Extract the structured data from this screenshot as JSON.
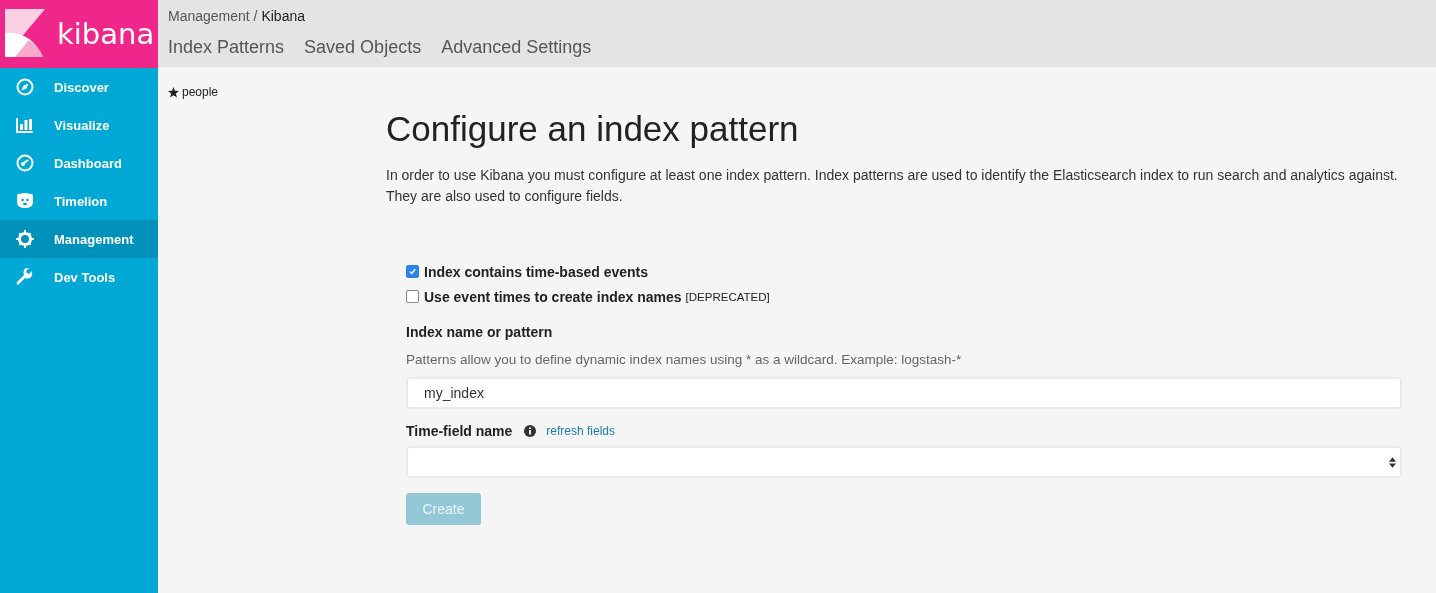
{
  "logo": {
    "text": "kibana"
  },
  "sidebar": {
    "items": [
      {
        "label": "Discover",
        "kind": "compass",
        "selected": false
      },
      {
        "label": "Visualize",
        "kind": "bars",
        "selected": false
      },
      {
        "label": "Dashboard",
        "kind": "gauge",
        "selected": false
      },
      {
        "label": "Timelion",
        "kind": "bear",
        "selected": false
      },
      {
        "label": "Management",
        "kind": "gear",
        "selected": true
      },
      {
        "label": "Dev Tools",
        "kind": "wrench",
        "selected": false
      }
    ]
  },
  "breadcrumb": {
    "parent": "Management / ",
    "current": "Kibana"
  },
  "tabs": [
    {
      "label": "Index Patterns",
      "selected": false
    },
    {
      "label": "Saved Objects",
      "selected": false
    },
    {
      "label": "Advanced Settings",
      "selected": false
    }
  ],
  "index_patterns": [
    {
      "label": "people",
      "default": true
    }
  ],
  "form": {
    "title": "Configure an index pattern",
    "intro": "In order to use Kibana you must configure at least one index pattern. Index patterns are used to identify the Elasticsearch index to run search and analytics against. They are also used to configure fields.",
    "options": [
      {
        "label": "Index contains time-based events",
        "checked": true
      },
      {
        "label": "Use event times to create index names",
        "note": "[DEPRECATED]",
        "checked": false
      }
    ],
    "name_label": "Index name or pattern",
    "name_help": "Patterns allow you to define dynamic index names using * as a wildcard. Example: logstash-*",
    "name_value": "my_index",
    "time_label": "Time-field name",
    "refresh_link": "refresh fields",
    "create_button": {
      "label": "Create",
      "disabled": true
    }
  }
}
